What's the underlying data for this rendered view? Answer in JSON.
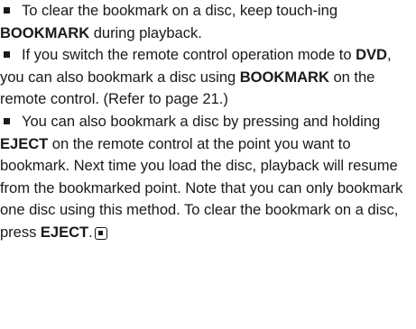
{
  "notes": [
    {
      "parts": [
        {
          "text": "To clear the bookmark on a disc, keep touch-ing ",
          "bold": false
        },
        {
          "text": "BOOKMARK",
          "bold": true
        },
        {
          "text": " during playback.",
          "bold": false
        }
      ]
    },
    {
      "parts": [
        {
          "text": "If you switch the remote control operation mode to ",
          "bold": false
        },
        {
          "text": "DVD",
          "bold": true
        },
        {
          "text": ", you can also bookmark a disc using ",
          "bold": false
        },
        {
          "text": "BOOKMARK",
          "bold": true
        },
        {
          "text": " on the remote control. (Refer to page 21.)",
          "bold": false
        }
      ]
    },
    {
      "parts": [
        {
          "text": "You can also bookmark a disc by pressing and holding ",
          "bold": false
        },
        {
          "text": "EJECT",
          "bold": true
        },
        {
          "text": " on the remote control at the point you want to bookmark. Next time you load the disc, playback will resume from the bookmarked point. Note that you can only bookmark one disc using this method. To clear the bookmark on a disc, press ",
          "bold": false
        },
        {
          "text": "EJECT",
          "bold": true
        },
        {
          "text": ".",
          "bold": false
        }
      ],
      "end_mark": "end-of-section-icon"
    }
  ]
}
